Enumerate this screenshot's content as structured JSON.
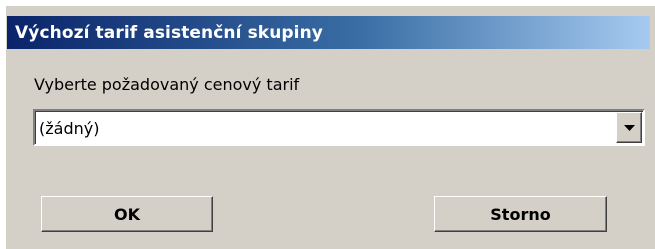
{
  "dialog": {
    "title": "Výchozí tarif asistenční skupiny",
    "field_label": "Vyberte požadovaný cenový tarif",
    "tariff_select": {
      "selected_value": "(žádný)"
    },
    "ok_label": "OK",
    "cancel_label": "Storno"
  },
  "colors": {
    "title_gradient_start": "#0a246a",
    "title_gradient_end": "#a6caf0",
    "face": "#d4d0c8"
  },
  "icons": {
    "dropdown": "chevron-down-icon"
  }
}
